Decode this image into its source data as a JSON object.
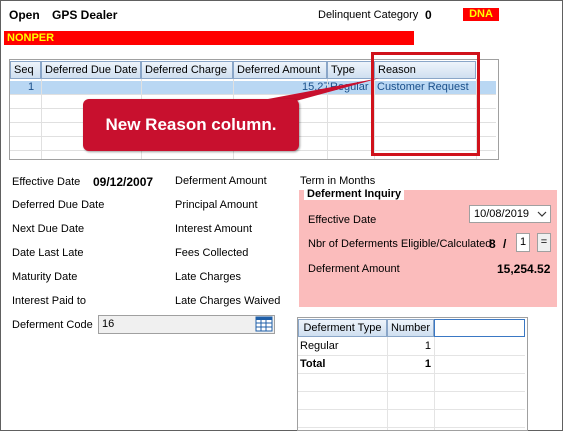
{
  "header": {
    "status": "Open",
    "dealer": "GPS Dealer",
    "delinquent_label": "Delinquent Category",
    "delinquent_value": "0",
    "dna_badge": "DNA",
    "nonper_banner": "NONPER"
  },
  "deferral_grid": {
    "columns": [
      "Seq",
      "Deferred Due Date",
      "Deferred Charge",
      "Deferred Amount",
      "Type",
      "Reason"
    ],
    "rows": [
      {
        "seq": "1",
        "deferred_due_date": "",
        "deferred_charge": "",
        "deferred_amount": "15.27",
        "type": "Regular",
        "reason": "Customer Request"
      }
    ]
  },
  "callout": {
    "text": "New Reason column."
  },
  "details_left": {
    "effective_date_label": "Effective Date",
    "effective_date_value": "09/12/2007",
    "deferred_due_date_label": "Deferred Due Date",
    "next_due_date_label": "Next Due Date",
    "date_last_late_label": "Date Last Late",
    "maturity_date_label": "Maturity Date",
    "interest_paid_to_label": "Interest Paid to",
    "deferment_code_label": "Deferment Code",
    "deferment_code_value": "16"
  },
  "details_middle": {
    "deferment_amount_label": "Deferment Amount",
    "principal_amount_label": "Principal Amount",
    "interest_amount_label": "Interest Amount",
    "fees_collected_label": "Fees Collected",
    "late_charges_label": "Late Charges",
    "late_charges_waived_label": "Late Charges Waived"
  },
  "inquiry": {
    "term_label": "Term in Months",
    "title": "Deferment Inquiry",
    "effective_date_label": "Effective Date",
    "effective_date_value": "10/08/2019",
    "nbr_label": "Nbr of Deferments Eligible/Calculated",
    "eligible_value": "8",
    "separator": "/",
    "calculated_value": "1",
    "equals_button": "=",
    "deferment_amount_label": "Deferment Amount",
    "deferment_amount_value": "15,254.52"
  },
  "summary_grid": {
    "columns": [
      "Deferment Type",
      "Number"
    ],
    "rows": [
      {
        "type": "Regular",
        "number": "1"
      },
      {
        "type": "Total",
        "number": "1"
      }
    ]
  },
  "colors": {
    "banner_red": "#ff0000",
    "banner_text": "#ffff00",
    "inquiry_bg": "#fbbcbc",
    "callout_red": "#c8102e",
    "selected_row": "#b9d7f3"
  }
}
